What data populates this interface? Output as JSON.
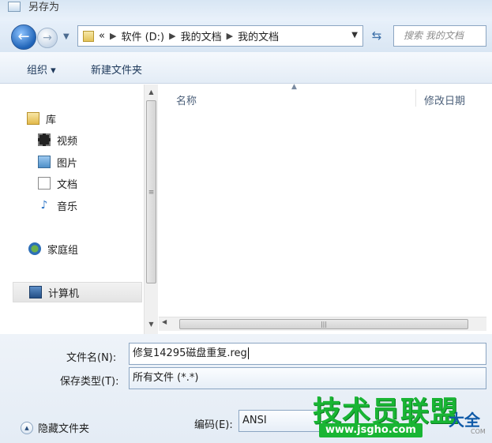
{
  "window": {
    "title": "另存为"
  },
  "nav": {
    "address_overflow": "«",
    "breadcrumbs": [
      "软件 (D:)",
      "我的文档",
      "我的文档"
    ],
    "search_placeholder": "搜索 我的文档"
  },
  "toolbar": {
    "organize_label": "组织 ▾",
    "new_folder_label": "新建文件夹"
  },
  "navpane": {
    "items": [
      {
        "label": "库",
        "icon": "library-icon"
      },
      {
        "label": "视频",
        "icon": "video-icon"
      },
      {
        "label": "图片",
        "icon": "picture-icon"
      },
      {
        "label": "文档",
        "icon": "document-icon"
      },
      {
        "label": "音乐",
        "icon": "music-icon"
      },
      {
        "label": "家庭组",
        "icon": "homegroup-icon"
      },
      {
        "label": "计算机",
        "icon": "computer-icon",
        "selected": true
      }
    ]
  },
  "filelist": {
    "columns": [
      "名称",
      "修改日期"
    ]
  },
  "form": {
    "filename_label": "文件名(N):",
    "filename_value": "修复14295磁盘重复.reg",
    "filetype_label": "保存类型(T):",
    "filetype_value": "所有文件  (*.*)",
    "encoding_label": "编码(E):",
    "encoding_value": "ANSI",
    "hide_folders_label": "隐藏文件夹"
  },
  "watermark": {
    "main": "技术员联盟",
    "side": "大全",
    "url": "www.jsgho.com",
    "com": "COM"
  }
}
